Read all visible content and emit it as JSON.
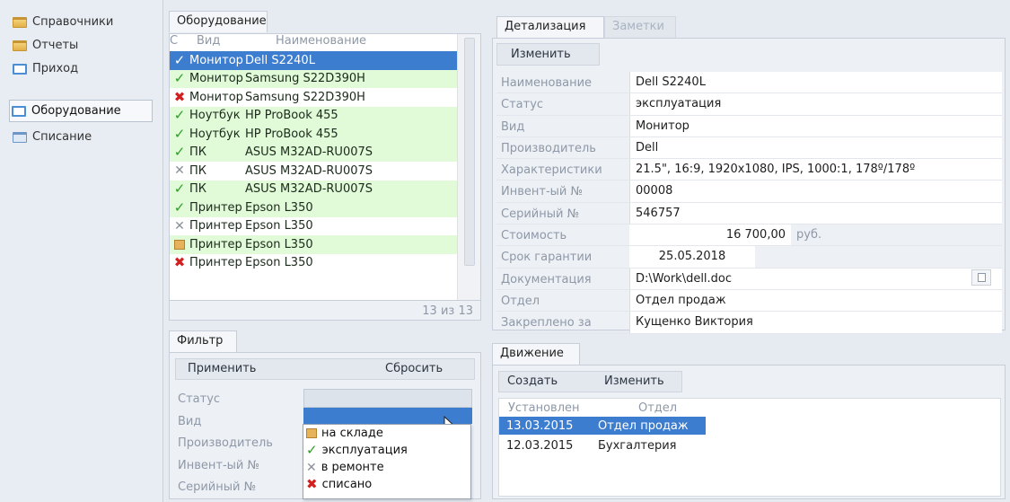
{
  "nav": {
    "items": [
      {
        "label": "Справочники",
        "icon": "folder-icon"
      },
      {
        "label": "Отчеты",
        "icon": "folder-icon"
      },
      {
        "label": "Приход",
        "icon": "document-icon"
      },
      {
        "label": "Оборудование",
        "icon": "document-icon",
        "active": true
      },
      {
        "label": "Списание",
        "icon": "calendar-icon"
      }
    ]
  },
  "equipment": {
    "tab": "Оборудование",
    "columns": [
      "С",
      "Вид",
      "Наименование"
    ],
    "rows": [
      {
        "status": "ok",
        "kind": "Монитор",
        "name": "Dell S2240L",
        "selected": true
      },
      {
        "status": "ok",
        "kind": "Монитор",
        "name": "Samsung S22D390H"
      },
      {
        "status": "written-off",
        "kind": "Монитор",
        "name": "Samsung S22D390H"
      },
      {
        "status": "ok",
        "kind": "Ноутбук",
        "name": "HP ProBook 455"
      },
      {
        "status": "ok",
        "kind": "Ноутбук",
        "name": "HP ProBook 455"
      },
      {
        "status": "ok",
        "kind": "ПК",
        "name": "ASUS M32AD-RU007S"
      },
      {
        "status": "repair",
        "kind": "ПК",
        "name": "ASUS M32AD-RU007S"
      },
      {
        "status": "ok",
        "kind": "ПК",
        "name": "ASUS M32AD-RU007S"
      },
      {
        "status": "ok",
        "kind": "Принтер",
        "name": "Epson L350"
      },
      {
        "status": "repair",
        "kind": "Принтер",
        "name": "Epson L350"
      },
      {
        "status": "stock",
        "kind": "Принтер",
        "name": "Epson L350"
      },
      {
        "status": "written-off",
        "kind": "Принтер",
        "name": "Epson L350"
      }
    ],
    "counter": "13 из 13"
  },
  "filter": {
    "tab": "Фильтр",
    "apply": "Применить",
    "reset": "Сбросить",
    "labels": [
      "Статус",
      "Вид",
      "Производитель",
      "Инвент-ый №",
      "Серийный №"
    ],
    "status_options": [
      {
        "label": "на складе",
        "icon": "box-icon"
      },
      {
        "label": "эксплуатация",
        "icon": "checkmark-icon"
      },
      {
        "label": "в ремонте",
        "icon": "tools-icon"
      },
      {
        "label": "списано",
        "icon": "cross-icon"
      }
    ]
  },
  "details": {
    "tabs": [
      "Детализация",
      "Заметки"
    ],
    "edit": "Изменить",
    "fields": [
      {
        "label": "Наименование",
        "value": "Dell S2240L"
      },
      {
        "label": "Статус",
        "value": "эксплуатация"
      },
      {
        "label": "Вид",
        "value": "Монитор"
      },
      {
        "label": "Производитель",
        "value": "Dell"
      },
      {
        "label": "Характеристики",
        "value": "21.5\", 16:9, 1920x1080, IPS, 1000:1, 178º/178º"
      },
      {
        "label": "Инвент-ый №",
        "value": "00008"
      },
      {
        "label": "Серийный №",
        "value": "546757"
      },
      {
        "label": "Стоимость",
        "value": "16 700,00",
        "suffix": "руб."
      },
      {
        "label": "Срок гарантии",
        "value": "25.05.2018"
      },
      {
        "label": "Документация",
        "value": "D:\\Work\\dell.doc"
      },
      {
        "label": "Отдел",
        "value": "Отдел продаж"
      },
      {
        "label": "Закреплено за",
        "value": "Кущенко Виктория"
      }
    ]
  },
  "movement": {
    "tab": "Движение",
    "create": "Создать",
    "edit": "Изменить",
    "columns": [
      "Установлен",
      "Отдел"
    ],
    "rows": [
      {
        "date": "13.03.2015",
        "dept": "Отдел продаж",
        "selected": true
      },
      {
        "date": "12.03.2015",
        "dept": "Бухгалтерия"
      }
    ]
  },
  "colors": {
    "selection": "#3c7dd0",
    "row_green": "#e1fad8",
    "ok": "#2e9d28",
    "written_off": "#d41f1f"
  }
}
